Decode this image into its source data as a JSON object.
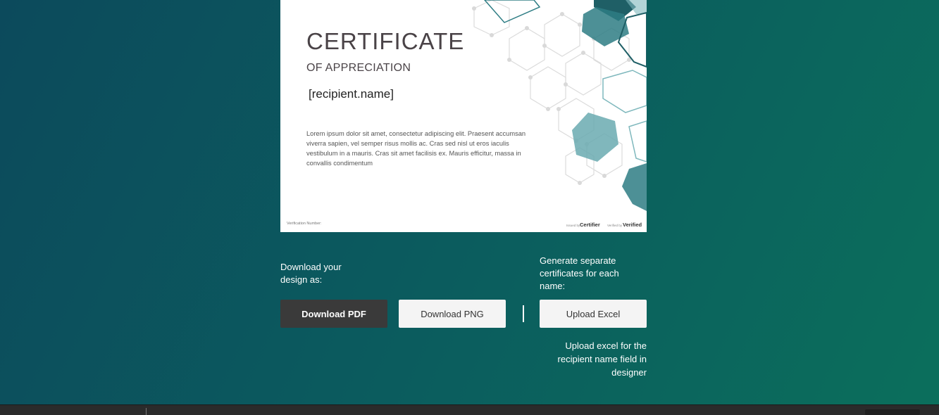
{
  "certificate": {
    "title": "CERTIFICATE",
    "subtitle": "OF APPRECIATION",
    "recipient": "[recipient.name]",
    "body": "Lorem ipsum dolor sit amet, consectetur adipiscing elit. Praesent accumsan viverra sapien, vel semper risus mollis ac. Cras sed nisl ut eros iaculis vestibulum in a mauris. Cras sit amet facilisis ex. Mauris efficitur, massa in convallis condimentum",
    "footer_left": "Verification Number:",
    "issued_by": "Issued by",
    "certifier": "Certifier",
    "verified_by": "Verified by",
    "verified": "Verified"
  },
  "download": {
    "label": "Download your design as:",
    "pdf_label": "Download PDF",
    "png_label": "Download PNG"
  },
  "generate": {
    "label": "Generate separate certificates for each name:",
    "upload_label": "Upload Excel",
    "hint": "Upload excel for the recipient name field in designer"
  },
  "colors": {
    "accent_dark": "#3a3a3a",
    "teal": "#2e7d84",
    "teal_light": "#7fb8bd"
  }
}
